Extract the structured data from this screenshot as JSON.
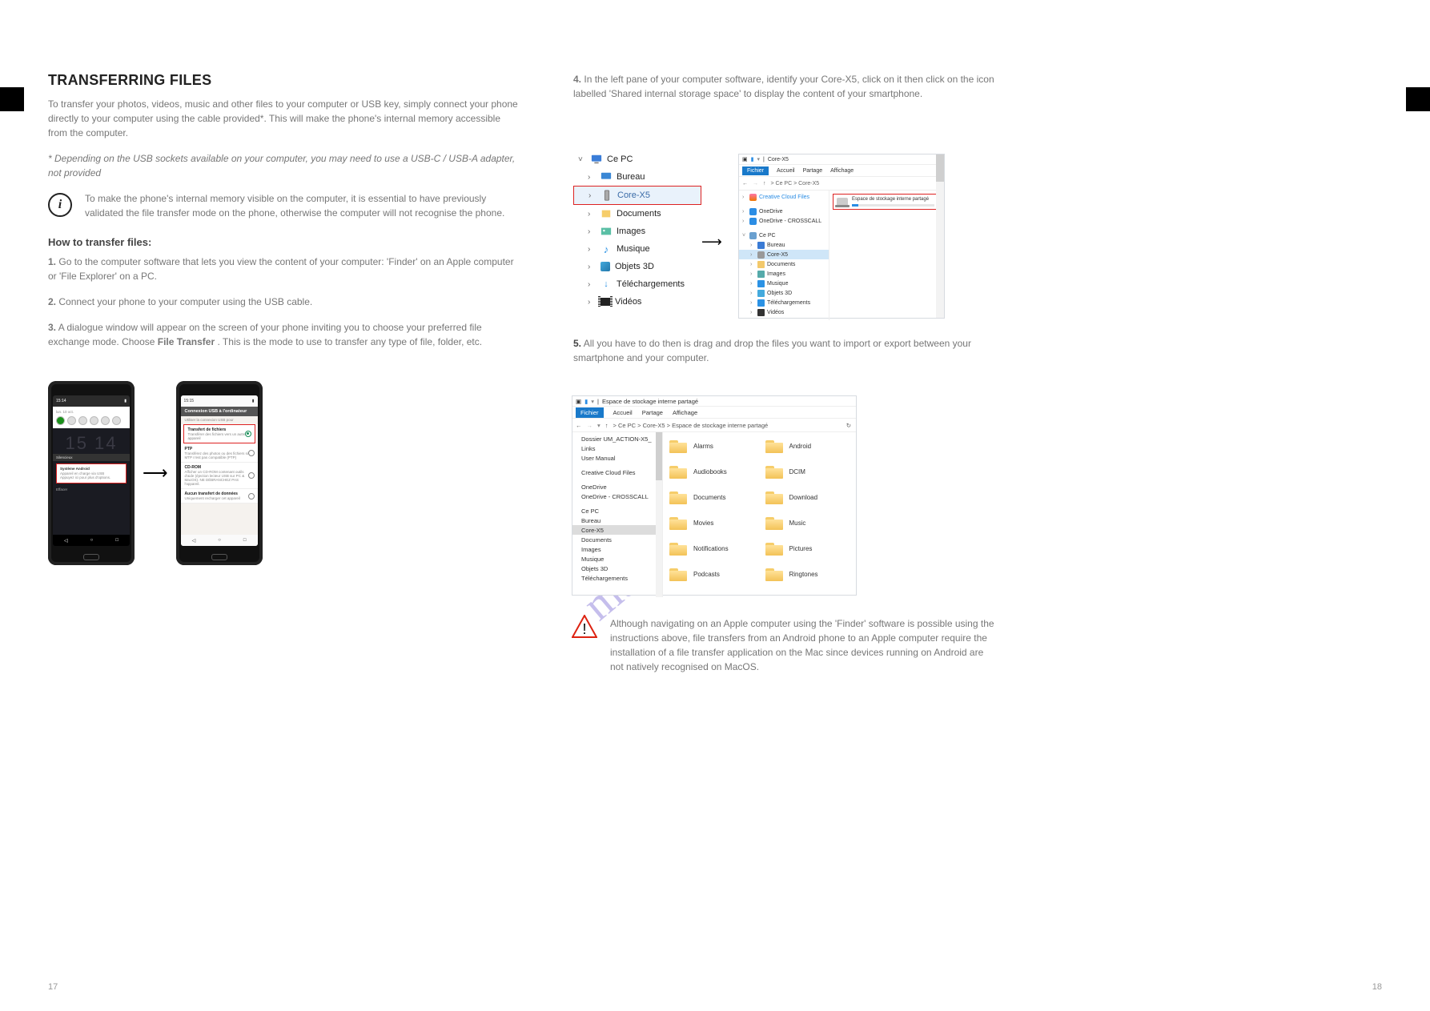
{
  "watermark": "manualshive.com",
  "page_numbers": {
    "left": "17",
    "right": "18"
  },
  "left": {
    "title": "TRANSFERRING FILES",
    "intro": "To transfer your photos, videos, music and other files to your computer or USB key, simply connect your phone directly to your computer using the cable provided*. This will make the phone's internal memory accessible from the computer.",
    "note_label": "*",
    "note_text": "Depending on the USB sockets available on your computer, you may need to use a USB-C / USB-A adapter, not provided",
    "info_text": "To make the phone's internal memory visible on the computer, it is essential to have previously validated the file transfer mode on the phone, otherwise the computer will not recognise the phone.",
    "sub1": "How to transfer files:",
    "step1_label": "1.",
    "step1": "Go to the computer software that lets you view the content of your computer: 'Finder' on an Apple computer or 'File Explorer' on a PC.",
    "step2_label": "2.",
    "step2": "Connect your phone to your computer using the USB cable.",
    "step3_label": "3.",
    "step3a": "A dialogue window will appear on the screen of your phone inviting you to choose your preferred file exchange mode. Choose ",
    "step3b_strong": "File Transfer",
    "step3b": ". This is the mode to use to transfer any type of file, folder, etc.",
    "phone1": {
      "status_time": "15:14",
      "quick_label": "",
      "section": "Silencieux",
      "notif_title": "Système Android",
      "notif1": "Appareil en charge via USB",
      "notif2": "Appuyez ici pour plus d'options.",
      "clear": "Effacer"
    },
    "phone2": {
      "status_time": "",
      "header": "Connexion USB à l'ordinateur",
      "sub": "Utiliser la connexion USB pour",
      "item1_t": "Transfert de fichiers",
      "item1_s": "Transférer des fichiers vers un autre appareil",
      "item2_t": "PTP",
      "item2_s": "Transférez des photos ou des fichiers si MTP n'est pas compatible (PTP)",
      "item3_t": "CD-ROM",
      "item3_s": "Afficher un CD-ROM contenant outils d'aide (éjection lecteur USB sur PC & MacOS). NE DÉBRANCHEZ PAS l'appareil.",
      "item4_t": "Aucun transfert de données",
      "item4_s": "Uniquement recharger cet appareil"
    }
  },
  "right": {
    "step4_label": "4.",
    "step4": "In the left pane of your computer software, identify your Core-X5, click on it then click on the icon labelled 'Shared internal storage space' to display the content of your smartphone.",
    "tree": {
      "root": "Ce PC",
      "items": [
        "Bureau",
        "Core-X5",
        "Documents",
        "Images",
        "Musique",
        "Objets 3D",
        "Téléchargements",
        "Vidéos"
      ]
    },
    "mini_explorer": {
      "title": "Core-X5",
      "tabs": [
        "Fichier",
        "Accueil",
        "Partage",
        "Affichage"
      ],
      "breadcrumb": "> Ce PC > Core-X5",
      "side": [
        "Creative Cloud Files",
        "OneDrive",
        "OneDrive - CROSSCALL",
        "Ce PC",
        "Bureau",
        "Core-X5",
        "Documents",
        "Images",
        "Musique",
        "Objets 3D",
        "Téléchargements",
        "Vidéos"
      ],
      "drive_label": "Espace de stockage interne partagé"
    },
    "step5_label": "5.",
    "step5": "All you have to do then is drag and drop the files you want to import or export between your smartphone and your computer.",
    "large_explorer": {
      "title": "Espace de stockage interne partagé",
      "tabs": [
        "Fichier",
        "Accueil",
        "Partage",
        "Affichage"
      ],
      "breadcrumb": "> Ce PC > Core-X5 > Espace de stockage interne partagé",
      "side": [
        "Dossier UM_ACTION-X5_",
        "Links",
        "User Manual",
        "Creative Cloud Files",
        "OneDrive",
        "OneDrive - CROSSCALL",
        "Ce PC",
        "Bureau",
        "Core-X5",
        "Documents",
        "Images",
        "Musique",
        "Objets 3D",
        "Téléchargements"
      ],
      "folders": [
        "Alarms",
        "Android",
        "Audiobooks",
        "DCIM",
        "Documents",
        "Download",
        "Movies",
        "Music",
        "Notifications",
        "Pictures",
        "Podcasts",
        "Ringtones"
      ]
    },
    "warn": "Although navigating on an Apple computer using the 'Finder' software is possible using the instructions above, file transfers from an Android phone to an Apple computer require the installation of a file transfer application on the Mac since devices running on Android are not natively recognised on MacOS."
  }
}
